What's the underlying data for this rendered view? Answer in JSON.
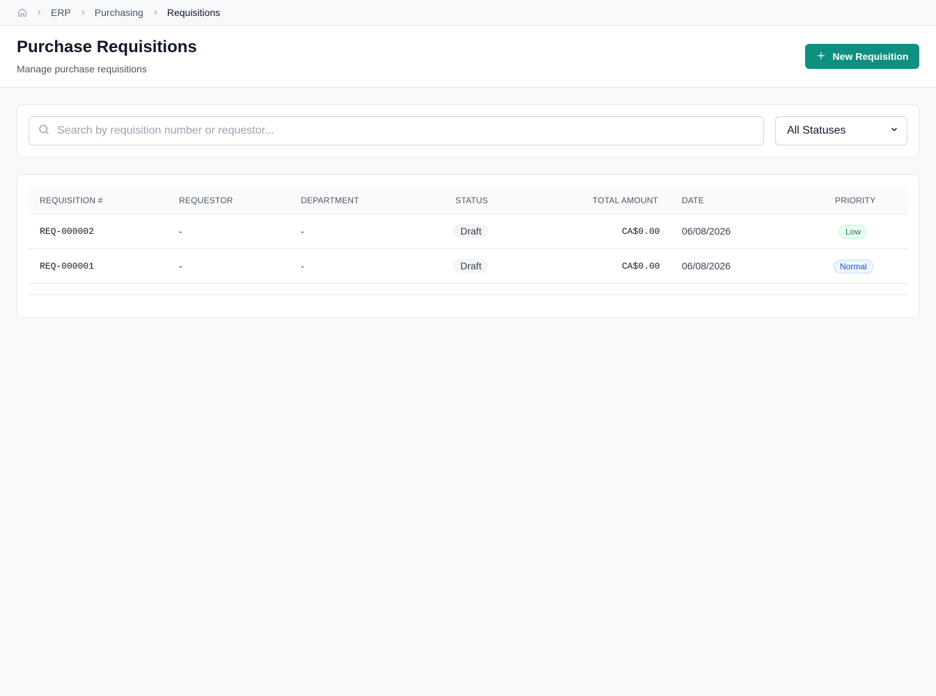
{
  "breadcrumb": {
    "items": [
      "ERP",
      "Purchasing"
    ],
    "current": "Requisitions"
  },
  "header": {
    "title": "Purchase Requisitions",
    "subtitle": "Manage purchase requisitions",
    "new_button_label": "New Requisition"
  },
  "filters": {
    "search_placeholder": "Search by requisition number or requestor...",
    "status_selected": "All Statuses"
  },
  "table": {
    "columns": [
      "REQUISITION #",
      "REQUESTOR",
      "DEPARTMENT",
      "STATUS",
      "TOTAL AMOUNT",
      "DATE",
      "PRIORITY"
    ],
    "rows": [
      {
        "number": "REQ-000002",
        "requestor": "-",
        "department": "-",
        "status": "Draft",
        "total": "CA$0.00",
        "date": "06/08/2026",
        "priority": "Low"
      },
      {
        "number": "REQ-000001",
        "requestor": "-",
        "department": "-",
        "status": "Draft",
        "total": "CA$0.00",
        "date": "06/08/2026",
        "priority": "Normal"
      }
    ]
  },
  "colors": {
    "accent": "#0f8f7f",
    "priority_low": "#15803d",
    "priority_normal": "#1d4ed8"
  }
}
